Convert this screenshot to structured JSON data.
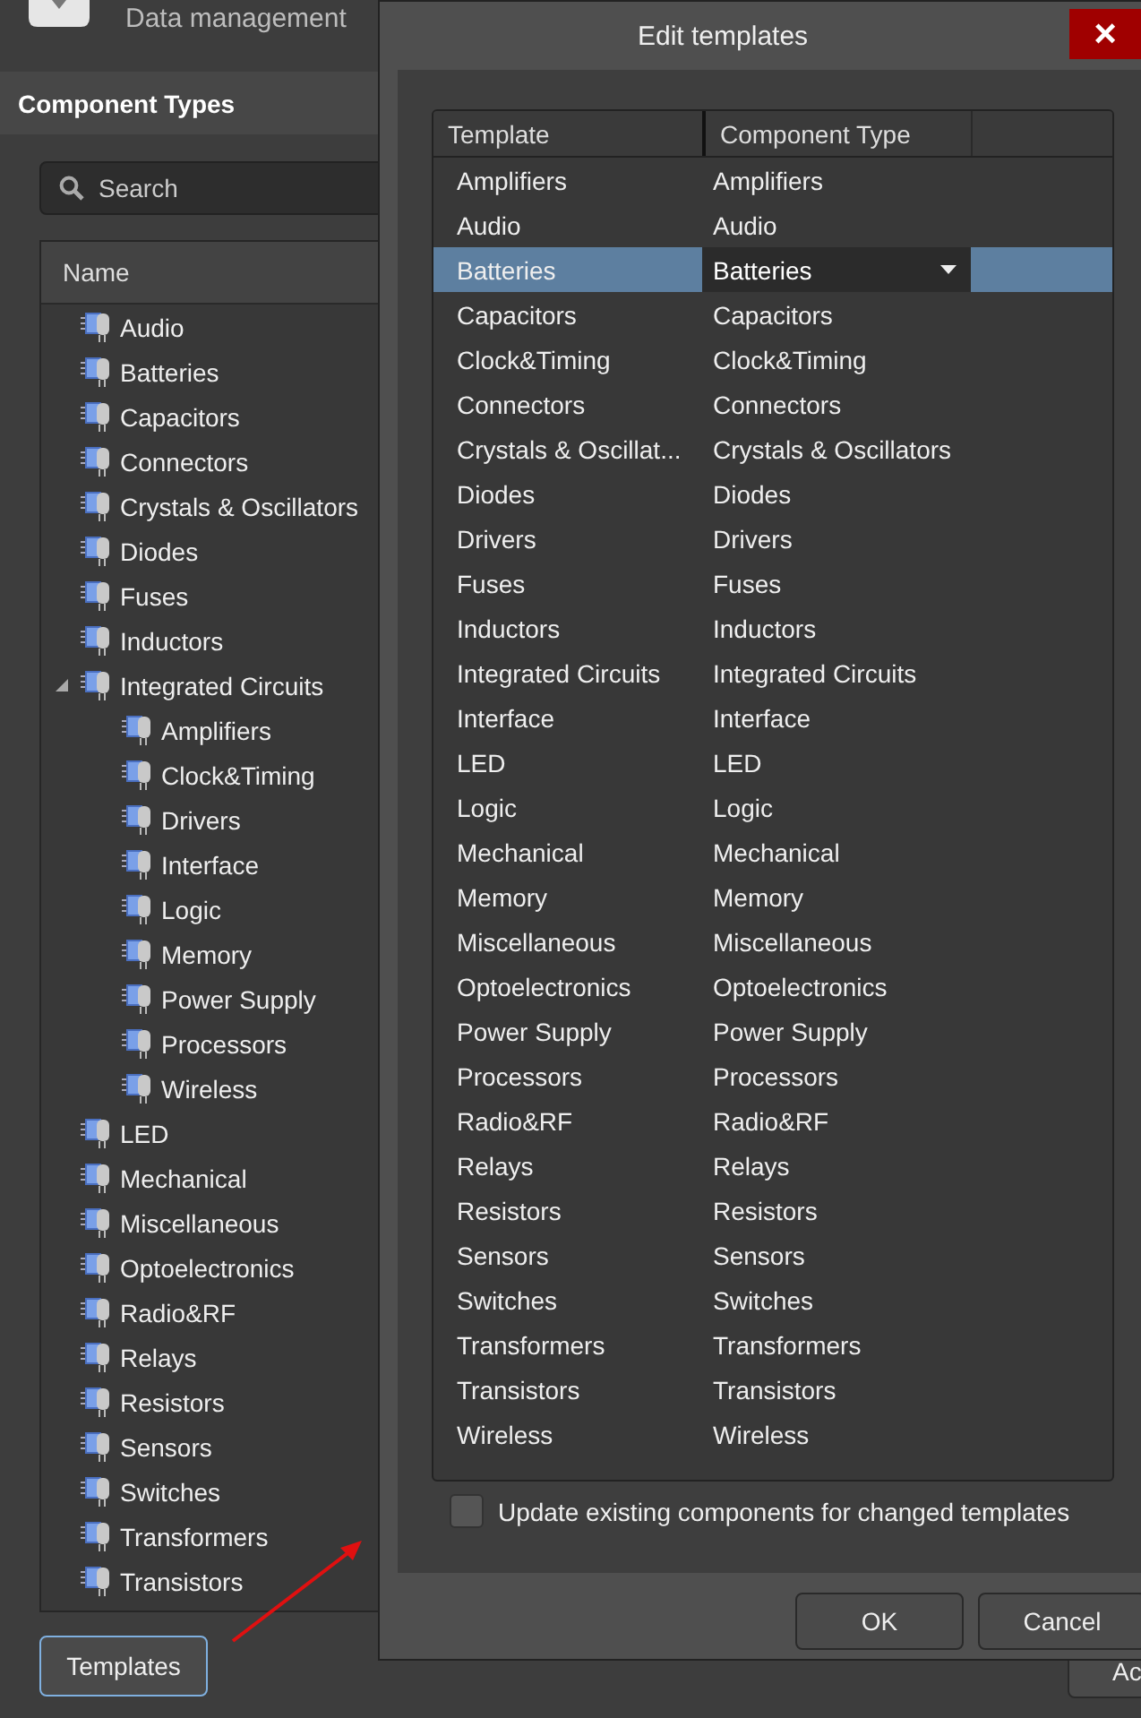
{
  "app": {
    "title": "Data management",
    "panel_title": "Component Types",
    "search": {
      "placeholder": "Search"
    },
    "tree_header": "Name",
    "tree": [
      {
        "label": "Audio"
      },
      {
        "label": "Batteries"
      },
      {
        "label": "Capacitors"
      },
      {
        "label": "Connectors"
      },
      {
        "label": "Crystals & Oscillators"
      },
      {
        "label": "Diodes"
      },
      {
        "label": "Fuses"
      },
      {
        "label": "Inductors"
      },
      {
        "label": "Integrated Circuits",
        "expanded": true,
        "children": [
          {
            "label": "Amplifiers"
          },
          {
            "label": "Clock&Timing"
          },
          {
            "label": "Drivers"
          },
          {
            "label": "Interface"
          },
          {
            "label": "Logic"
          },
          {
            "label": "Memory"
          },
          {
            "label": "Power Supply"
          },
          {
            "label": "Processors"
          },
          {
            "label": "Wireless"
          }
        ]
      },
      {
        "label": "LED"
      },
      {
        "label": "Mechanical"
      },
      {
        "label": "Miscellaneous"
      },
      {
        "label": "Optoelectronics"
      },
      {
        "label": "Radio&RF"
      },
      {
        "label": "Relays"
      },
      {
        "label": "Resistors"
      },
      {
        "label": "Sensors"
      },
      {
        "label": "Switches"
      },
      {
        "label": "Transformers"
      },
      {
        "label": "Transistors"
      }
    ],
    "templates_button": "Templates",
    "edge_button": "Ac"
  },
  "dialog": {
    "title": "Edit templates",
    "close": "×",
    "columns": [
      "Template",
      "Component Type"
    ],
    "rows": [
      {
        "template": "Amplifiers",
        "type": "Amplifiers",
        "selected": false
      },
      {
        "template": "Audio",
        "type": "Audio",
        "selected": false
      },
      {
        "template": "Batteries",
        "type": "Batteries",
        "selected": true
      },
      {
        "template": "Capacitors",
        "type": "Capacitors",
        "selected": false
      },
      {
        "template": "Clock&Timing",
        "type": "Clock&Timing",
        "selected": false
      },
      {
        "template": "Connectors",
        "type": "Connectors",
        "selected": false
      },
      {
        "template": "Crystals & Oscillat...",
        "type": "Crystals & Oscillators",
        "selected": false
      },
      {
        "template": "Diodes",
        "type": "Diodes",
        "selected": false
      },
      {
        "template": "Drivers",
        "type": "Drivers",
        "selected": false
      },
      {
        "template": "Fuses",
        "type": "Fuses",
        "selected": false
      },
      {
        "template": "Inductors",
        "type": "Inductors",
        "selected": false
      },
      {
        "template": "Integrated Circuits",
        "type": "Integrated Circuits",
        "selected": false
      },
      {
        "template": "Interface",
        "type": "Interface",
        "selected": false
      },
      {
        "template": "LED",
        "type": "LED",
        "selected": false
      },
      {
        "template": "Logic",
        "type": "Logic",
        "selected": false
      },
      {
        "template": "Mechanical",
        "type": "Mechanical",
        "selected": false
      },
      {
        "template": "Memory",
        "type": "Memory",
        "selected": false
      },
      {
        "template": "Miscellaneous",
        "type": "Miscellaneous",
        "selected": false
      },
      {
        "template": "Optoelectronics",
        "type": "Optoelectronics",
        "selected": false
      },
      {
        "template": "Power Supply",
        "type": "Power Supply",
        "selected": false
      },
      {
        "template": "Processors",
        "type": "Processors",
        "selected": false
      },
      {
        "template": "Radio&RF",
        "type": "Radio&RF",
        "selected": false
      },
      {
        "template": "Relays",
        "type": "Relays",
        "selected": false
      },
      {
        "template": "Resistors",
        "type": "Resistors",
        "selected": false
      },
      {
        "template": "Sensors",
        "type": "Sensors",
        "selected": false
      },
      {
        "template": "Switches",
        "type": "Switches",
        "selected": false
      },
      {
        "template": "Transformers",
        "type": "Transformers",
        "selected": false
      },
      {
        "template": "Transistors",
        "type": "Transistors",
        "selected": false
      },
      {
        "template": "Wireless",
        "type": "Wireless",
        "selected": false
      }
    ],
    "update_option": {
      "label": "Update existing components for changed templates",
      "checked": false
    },
    "buttons": [
      "OK",
      "Cancel"
    ]
  }
}
